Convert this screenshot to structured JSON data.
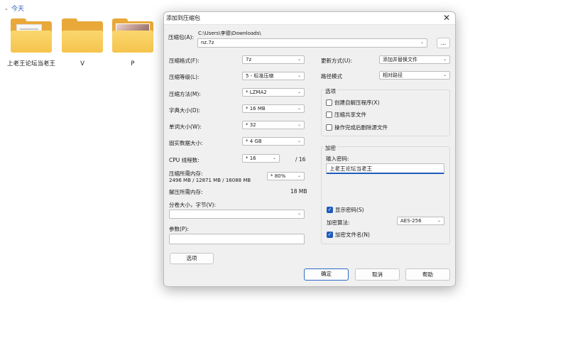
{
  "explorer": {
    "group_label": "今天",
    "items": [
      {
        "name": "上老王论坛当老王",
        "kind": "folder-docs"
      },
      {
        "name": "V",
        "kind": "folder"
      },
      {
        "name": "P",
        "kind": "folder-photo"
      }
    ]
  },
  "dialog": {
    "title": "添加到压缩包",
    "close_glyph": "✕",
    "archive": {
      "label": "压缩包(A):",
      "folder": "C:\\Users\\李德\\Downloads\\",
      "filename": "nz.7z",
      "browse_label": "..."
    },
    "left": {
      "format": {
        "label": "压缩格式(F):",
        "value": "7z"
      },
      "level": {
        "label": "压缩等级(L):",
        "value": "5 - 标准压缩"
      },
      "method": {
        "label": "压缩方法(M):",
        "value": "* LZMA2"
      },
      "dict": {
        "label": "字典大小(D):",
        "value": "* 16 MB"
      },
      "word": {
        "label": "单词大小(W):",
        "value": "* 32"
      },
      "solid": {
        "label": "固实数据大小:",
        "value": "* 4 GB"
      },
      "cpu": {
        "label": "CPU 线程数:",
        "value": "* 16",
        "total": "/ 16"
      },
      "mem_compress": {
        "label": "压缩所需内存:",
        "detail": "2496 MB / 12871 MB / 16088 MB",
        "value": "* 80%"
      },
      "mem_decompress": {
        "label": "解压所需内存:",
        "value": "18 MB"
      },
      "split": {
        "label": "分卷大小，字节(V):",
        "value": ""
      },
      "params": {
        "label": "参数(P):",
        "value": ""
      },
      "options_button": "选项"
    },
    "right": {
      "update": {
        "label": "更新方式(U):",
        "value": "添加并替换文件"
      },
      "path": {
        "label": "路径模式",
        "value": "相对路径"
      },
      "options": {
        "title": "选项",
        "sfx": {
          "label": "创建自解压程序(X)",
          "checked": false
        },
        "shared": {
          "label": "压缩共享文件",
          "checked": false
        },
        "delete": {
          "label": "操作完成后删除源文件",
          "checked": false
        }
      },
      "encryption": {
        "title": "加密",
        "password_label": "输入密码:",
        "password_value": "上老王论坛当老王",
        "show_password": {
          "label": "显示密码(S)",
          "checked": true
        },
        "method_label": "加密算法:",
        "method_value": "AES-256",
        "encrypt_names": {
          "label": "加密文件名(N)",
          "checked": true
        }
      }
    },
    "buttons": {
      "ok": "确定",
      "cancel": "取消",
      "help": "帮助"
    },
    "check_glyph": "✓",
    "dropdown_glyph": "⌄"
  },
  "colors": {
    "accent": "#1f5bbd",
    "folder": "#f5c44e",
    "dialog_bg": "#f0f0f0"
  }
}
